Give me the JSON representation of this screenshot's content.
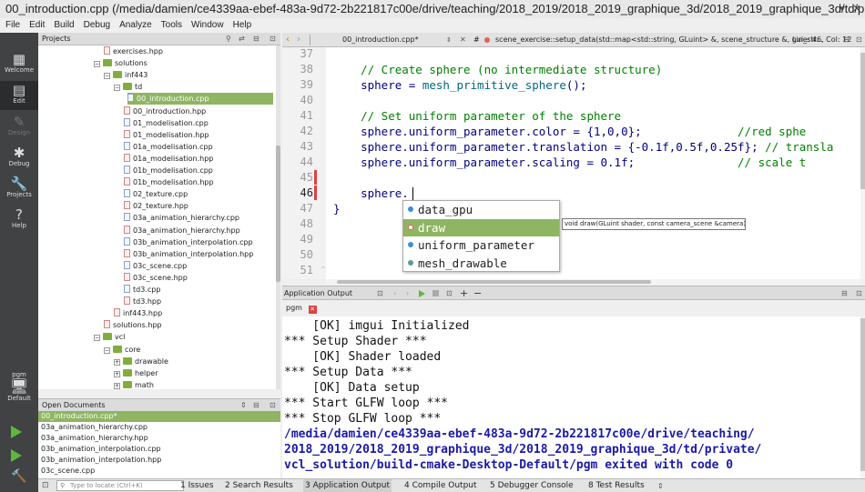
{
  "window": {
    "title": "00_introduction.cpp (/media/damien/ce4339aa-ebef-483a-9d72-2b221817c00e/drive/teaching/2018_2019/2018_2019_graphique_3d/2018_2019_graphique_3d/td/pri...",
    "controls": [
      "▾",
      "✕"
    ]
  },
  "menu": [
    "File",
    "Edit",
    "Build",
    "Debug",
    "Analyze",
    "Tools",
    "Window",
    "Help"
  ],
  "modes": [
    {
      "label": "Welcome",
      "icon": "grid-icon",
      "glyph": "▦",
      "active": false
    },
    {
      "label": "Edit",
      "icon": "edit-icon",
      "glyph": "▤",
      "active": true
    },
    {
      "label": "Design",
      "icon": "design-icon",
      "glyph": "✎",
      "active": false,
      "disabled": true
    },
    {
      "label": "Debug",
      "icon": "debug-icon",
      "glyph": "✱",
      "active": false
    },
    {
      "label": "Projects",
      "icon": "wrench-icon",
      "glyph": "🔧",
      "active": false
    },
    {
      "label": "Help",
      "icon": "help-icon",
      "glyph": "?",
      "active": false
    }
  ],
  "kit": {
    "name": "pgm",
    "label": "Default"
  },
  "projects": {
    "header": "Projects",
    "tree": [
      {
        "label": "exercises.hpp",
        "kind": "h",
        "indent": 5
      },
      {
        "label": "solutions",
        "kind": "folder",
        "indent": 4,
        "exp": "−"
      },
      {
        "label": "inf443",
        "kind": "folder",
        "indent": 5,
        "exp": "−"
      },
      {
        "label": "td",
        "kind": "folder",
        "indent": 6,
        "exp": "−"
      },
      {
        "label": "00_introduction.cpp",
        "kind": "c",
        "indent": 7,
        "sel": true
      },
      {
        "label": "00_introduction.hpp",
        "kind": "h",
        "indent": 7
      },
      {
        "label": "01_modelisation.cpp",
        "kind": "c",
        "indent": 7
      },
      {
        "label": "01_modelisation.hpp",
        "kind": "h",
        "indent": 7
      },
      {
        "label": "01a_modelisation.cpp",
        "kind": "c",
        "indent": 7
      },
      {
        "label": "01a_modelisation.hpp",
        "kind": "h",
        "indent": 7
      },
      {
        "label": "01b_modelisation.cpp",
        "kind": "c",
        "indent": 7
      },
      {
        "label": "01b_modelisation.hpp",
        "kind": "h",
        "indent": 7
      },
      {
        "label": "02_texture.cpp",
        "kind": "c",
        "indent": 7
      },
      {
        "label": "02_texture.hpp",
        "kind": "h",
        "indent": 7
      },
      {
        "label": "03a_animation_hierarchy.cpp",
        "kind": "c",
        "indent": 7
      },
      {
        "label": "03a_animation_hierarchy.hpp",
        "kind": "h",
        "indent": 7
      },
      {
        "label": "03b_animation_interpolation.cpp",
        "kind": "c",
        "indent": 7
      },
      {
        "label": "03b_animation_interpolation.hpp",
        "kind": "h",
        "indent": 7
      },
      {
        "label": "03c_scene.cpp",
        "kind": "c",
        "indent": 7
      },
      {
        "label": "03c_scene.hpp",
        "kind": "h",
        "indent": 7
      },
      {
        "label": "td3.cpp",
        "kind": "c",
        "indent": 7
      },
      {
        "label": "td3.hpp",
        "kind": "h",
        "indent": 7
      },
      {
        "label": "inf443.hpp",
        "kind": "h",
        "indent": 6
      },
      {
        "label": "solutions.hpp",
        "kind": "h",
        "indent": 5
      },
      {
        "label": "vcl",
        "kind": "folder",
        "indent": 4,
        "exp": "−"
      },
      {
        "label": "core",
        "kind": "folder",
        "indent": 5,
        "exp": "−"
      },
      {
        "label": "drawable",
        "kind": "folder",
        "indent": 6,
        "exp": "+"
      },
      {
        "label": "helper",
        "kind": "folder",
        "indent": 6,
        "exp": "+"
      },
      {
        "label": "math",
        "kind": "folder",
        "indent": 6,
        "exp": "+"
      }
    ]
  },
  "open_documents": {
    "header": "Open Documents",
    "items": [
      {
        "label": "00_introduction.cpp*",
        "sel": true
      },
      {
        "label": "03a_animation_hierarchy.cpp"
      },
      {
        "label": "03a_animation_hierarchy.hpp"
      },
      {
        "label": "03b_animation_interpolation.cpp"
      },
      {
        "label": "03b_animation_interpolation.hpp"
      },
      {
        "label": "03c_scene.cpp"
      }
    ]
  },
  "editor_toolbar": {
    "file": "00_introduction.cpp*",
    "symbol": "scene_exercise::setup_data(std::map<std::string, GLuint> &, scene_structure &, gui_str...",
    "position": "Line: 46, Col: 12",
    "hash": "#"
  },
  "code": {
    "line_numbers": [
      "37",
      "38",
      "39",
      "40",
      "41",
      "42",
      "43",
      "44",
      "45",
      "46",
      "47",
      "48",
      "49",
      "50",
      "51"
    ],
    "current_line": "46",
    "lines": [
      [],
      [
        {
          "c": "cmt",
          "t": "    // Create sphere (no intermediate structure)"
        }
      ],
      [
        {
          "c": "tx",
          "t": "    sphere = "
        },
        {
          "c": "fn",
          "t": "mesh_primitive_sphere"
        },
        {
          "c": "tx",
          "t": "();"
        }
      ],
      [],
      [
        {
          "c": "cmt",
          "t": "    // Set uniform parameter of the sphere"
        }
      ],
      [
        {
          "c": "tx",
          "t": "    sphere.uniform_parameter.color = {1,0,0};              "
        },
        {
          "c": "cmt",
          "t": "//red sphe"
        }
      ],
      [
        {
          "c": "tx",
          "t": "    sphere.uniform_parameter.translation = {-0.1f,0.5f,0.25f}; "
        },
        {
          "c": "cmt",
          "t": "// transla"
        }
      ],
      [
        {
          "c": "tx",
          "t": "    sphere.uniform_parameter.scaling = 0.1f;               "
        },
        {
          "c": "cmt",
          "t": "// scale t"
        }
      ],
      [],
      [
        {
          "c": "tx",
          "t": "    sphere."
        }
      ],
      [
        {
          "c": "tx",
          "t": "}"
        }
      ],
      [],
      [],
      [],
      []
    ]
  },
  "completion": {
    "items": [
      {
        "label": "data_gpu",
        "color": "#3b8fd6"
      },
      {
        "label": "draw",
        "color": "#e06060",
        "sel": true
      },
      {
        "label": "uniform_parameter",
        "color": "#3b8fd6"
      },
      {
        "label": "mesh_drawable",
        "color": "#5a9c9c"
      }
    ],
    "tooltip": "void draw(GLuint shader, const camera_scene &camera)"
  },
  "output": {
    "header": "Application Output",
    "tab": "pgm",
    "lines": [
      {
        "t": "    [OK] imgui Initialized",
        "blue": false
      },
      {
        "t": "*** Setup Shader ***",
        "blue": false
      },
      {
        "t": "    [OK] Shader loaded",
        "blue": false
      },
      {
        "t": "*** Setup Data ***",
        "blue": false
      },
      {
        "t": "    [OK] Data setup",
        "blue": false
      },
      {
        "t": "*** Start GLFW loop ***",
        "blue": false
      },
      {
        "t": "*** Stop GLFW loop ***",
        "blue": false
      },
      {
        "t": "/media/damien/ce4339aa-ebef-483a-9d72-2b221817c00e/drive/teaching/",
        "blue": true
      },
      {
        "t": "2018_2019/2018_2019_graphique_3d/2018_2019_graphique_3d/td/private/",
        "blue": true
      },
      {
        "t": "vcl_solution/build-cmake-Desktop-Default/pgm exited with code 0",
        "blue": true
      }
    ]
  },
  "status": {
    "locate_placeholder": "Type to locate (Ctrl+K)",
    "tabs": [
      "1 Issues",
      "2 Search Results",
      "3 Application Output",
      "4 Compile Output",
      "5 Debugger Console",
      "8 Test Results"
    ]
  }
}
